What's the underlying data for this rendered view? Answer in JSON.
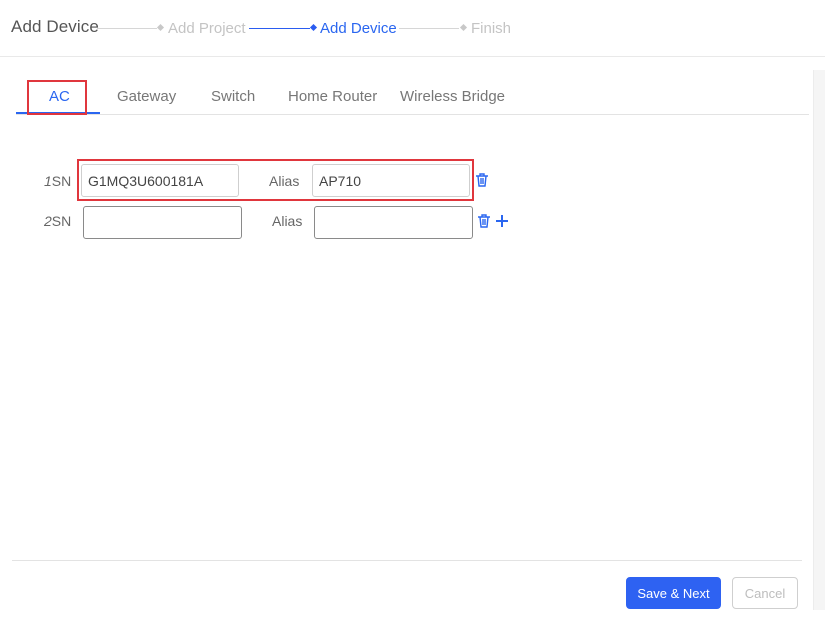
{
  "header": {
    "title": "Add Device",
    "steps": [
      {
        "label": "Add Project",
        "active": false
      },
      {
        "label": "Add Device",
        "active": true
      },
      {
        "label": "Finish",
        "active": false
      }
    ]
  },
  "tabs": [
    {
      "label": "AC",
      "active": true
    },
    {
      "label": "Gateway",
      "active": false
    },
    {
      "label": "Switch",
      "active": false
    },
    {
      "label": "Home Router",
      "active": false
    },
    {
      "label": "Wireless Bridge",
      "active": false
    }
  ],
  "rows": [
    {
      "index": "1",
      "sn_label": "SN",
      "sn_value": "G1MQ3U600181A",
      "alias_label": "Alias",
      "alias_value": "AP710"
    },
    {
      "index": "2",
      "sn_label": "SN",
      "sn_value": "",
      "alias_label": "Alias",
      "alias_value": ""
    }
  ],
  "footer": {
    "save_label": "Save & Next",
    "cancel_label": "Cancel"
  },
  "colors": {
    "accent": "#2a66f0",
    "primary_button": "#2e62f2",
    "highlight": "#e0363d"
  },
  "icons": {
    "delete": "trash-icon",
    "add": "plus-icon"
  }
}
